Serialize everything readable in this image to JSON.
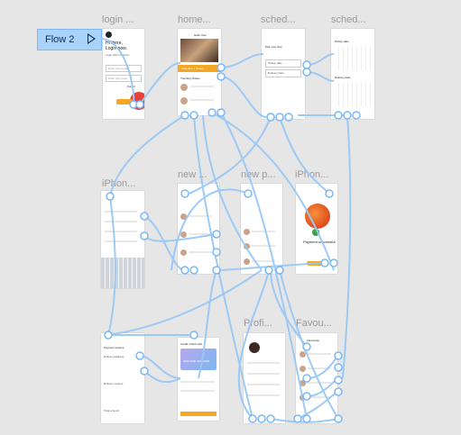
{
  "flow": {
    "label": "Flow 2"
  },
  "frames": {
    "login": {
      "title": "login ...",
      "hi": "Hi there,",
      "sub": "Login now.",
      "desc": "Login with Coolcorn",
      "email_ph": "Enter your email",
      "pass_ph": "Enter your pass",
      "forgot": "Forgot",
      "login_btn": "Login"
    },
    "home": {
      "title": "home...",
      "greet": "Hello User",
      "schedule_btn": "Schedule a Pickup",
      "trending": "Trending Videos"
    },
    "sched1": {
      "title": "sched...",
      "heading": "Pick your time",
      "opt1": "Pickup date",
      "opt2": "Delivery date"
    },
    "sched2": {
      "title": "sched...",
      "heading": "Pickup date",
      "heading2": "Delivery date"
    },
    "iphone": {
      "title": "iPhon..."
    },
    "new1": {
      "title": "new ..."
    },
    "new2": {
      "title": "new p..."
    },
    "iphone2": {
      "title": "iPhon...",
      "success": "Payment successful"
    },
    "payment": {
      "title": "",
      "heading": "Payment options",
      "delivery": "Delivery address",
      "options": "Delivery options",
      "total": "Total amount"
    },
    "card": {
      "title": "",
      "heading": "Credit / Debit card",
      "number": "0000 0000 0000 0000",
      "btn": "Pay now"
    },
    "profile": {
      "title": "Profi..."
    },
    "favourites": {
      "title": "Favou...",
      "heading": "Favourites"
    }
  }
}
